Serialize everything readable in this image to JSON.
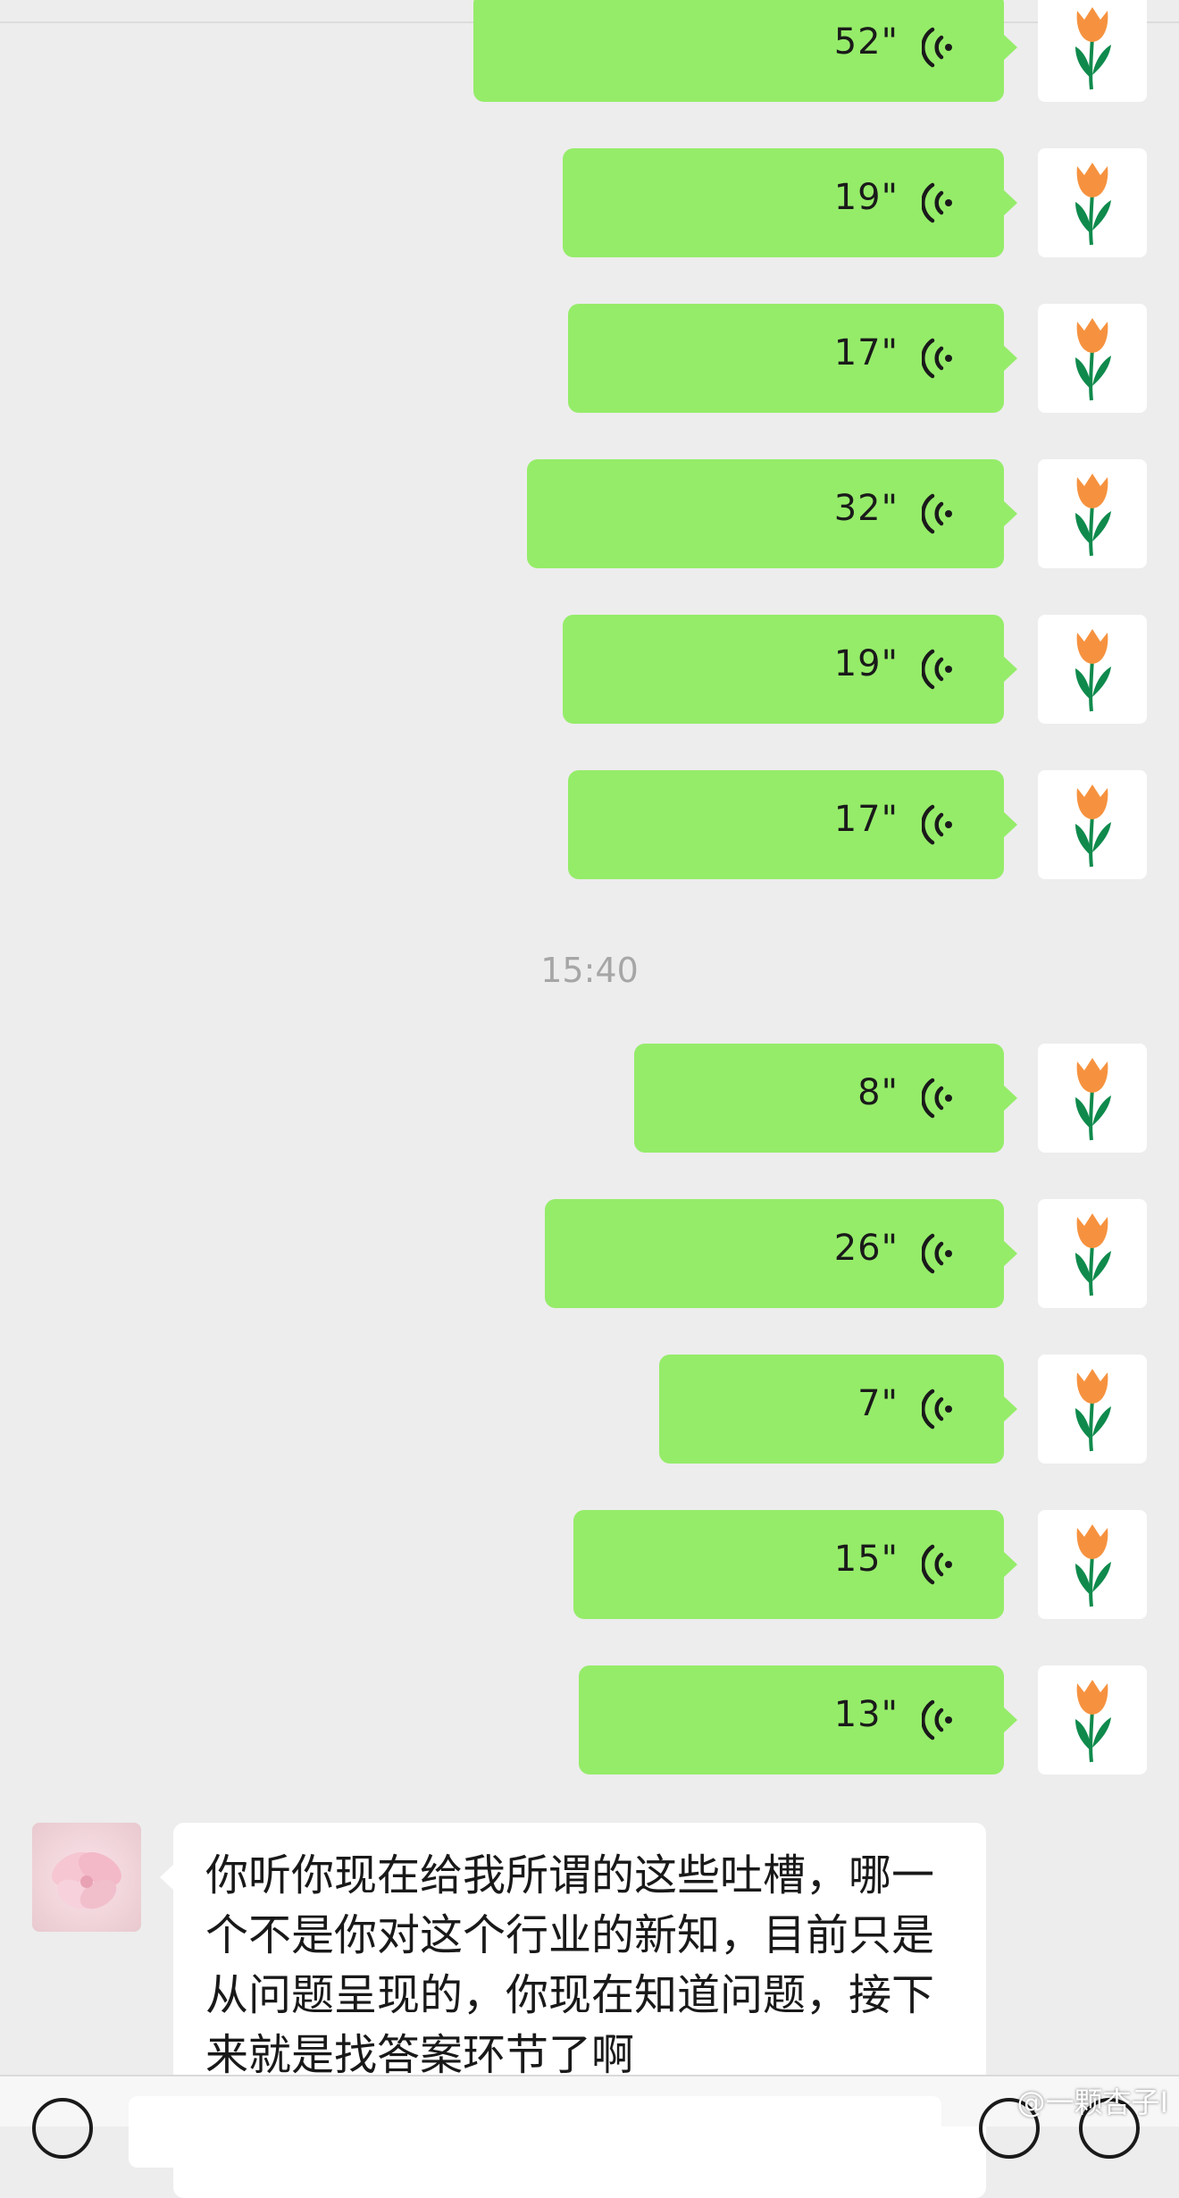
{
  "messages": [
    {
      "duration": "52\""
    },
    {
      "duration": "19\""
    },
    {
      "duration": "17\""
    },
    {
      "duration": "32\""
    },
    {
      "duration": "19\""
    },
    {
      "duration": "17\""
    },
    {
      "duration": "8\""
    },
    {
      "duration": "26\""
    },
    {
      "duration": "7\""
    },
    {
      "duration": "15\""
    },
    {
      "duration": "13\""
    }
  ],
  "timestamp": "15:40",
  "incoming": {
    "text": "你听你现在给我所谓的这些吐槽，哪一个不是你对这个行业的新知，目前只是从问题呈现的，你现在知道问题，接下来就是找答案环节了啊"
  },
  "watermark": "@一颗杏子I",
  "colors": {
    "outgoing_bubble": "#95ec69",
    "incoming_bubble": "#ffffff",
    "background": "#ededed"
  }
}
